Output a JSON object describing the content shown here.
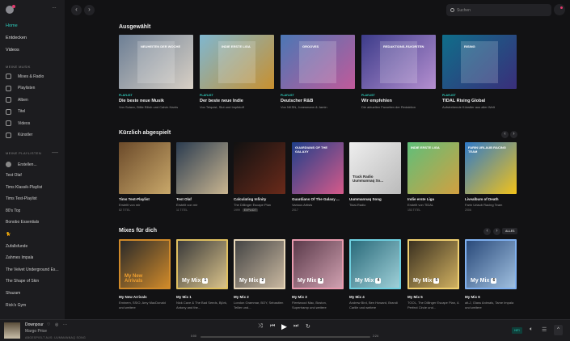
{
  "sidebar": {
    "nav": [
      {
        "label": "Home",
        "active": true
      },
      {
        "label": "Entdecken"
      },
      {
        "label": "Videos"
      }
    ],
    "my_music_title": "MEINE MUSIK",
    "my_music": [
      {
        "label": "Mixes & Radio",
        "icon": "radio-icon"
      },
      {
        "label": "Playlisten",
        "icon": "playlist-icon"
      },
      {
        "label": "Alben",
        "icon": "album-icon"
      },
      {
        "label": "Titel",
        "icon": "note-icon"
      },
      {
        "label": "Videos",
        "icon": "video-icon"
      },
      {
        "label": "Künstler",
        "icon": "mic-icon"
      }
    ],
    "playlists_title": "MEINE PLAYLISTEN",
    "create_label": "Erstellen...",
    "playlists": [
      "Test Olaf",
      "Tims Klassik-Playlist",
      "Tims Test-Playlist",
      "80's Top",
      "Bonobo Essentials",
      "🐈",
      "Zufallsfunde",
      "Zahmes Impala",
      "The Velvet Underground Es...",
      "The Shape of Skin",
      "Shazam",
      "Rick's Gym"
    ]
  },
  "header": {
    "search_placeholder": "Suchen"
  },
  "featured": {
    "title": "Ausgewählt",
    "items": [
      {
        "tag": "PLAYLIST",
        "title": "Die beste neue Musik",
        "sub": "Von Sulavx, Billie Eilish und Calvin Harris",
        "art_text": "Neuheiten der Woche",
        "colors": [
          "#6d7f95",
          "#d8d0c5"
        ]
      },
      {
        "tag": "PLAYLIST",
        "title": "Der beste neue Indie",
        "sub": "Von Telquist, Slut und Impfstoff",
        "art_text": "Indie Erste Liga",
        "colors": [
          "#7fb7d0",
          "#c8902f"
        ]
      },
      {
        "tag": "PLAYLIST",
        "title": "Deutscher R&B",
        "sub": "Von NKSN, Jonesmann & Jamin",
        "art_text": "Grooves",
        "colors": [
          "#4b77b5",
          "#c05a9a"
        ]
      },
      {
        "tag": "PLAYLIST",
        "title": "Wir empfehlen",
        "sub": "Die aktuellen Favoriten der Redaktion",
        "art_text": "Redaktions-favoriten",
        "colors": [
          "#3c3c8a",
          "#b58fd0"
        ]
      },
      {
        "tag": "PLAYLIST",
        "title": "TIDAL Rising Global",
        "sub": "Aufstrebende Künstler aus aller Welt",
        "art_text": "Rising",
        "colors": [
          "#0f6e8a",
          "#3a2e7a"
        ]
      }
    ]
  },
  "recent": {
    "title": "Kürzlich abgespielt",
    "items": [
      {
        "title": "Tims Test-Playlist",
        "sub": "Erstellt von mir",
        "meta": "82 TITEL",
        "colors": [
          "#6b4a2a",
          "#c9a86a"
        ]
      },
      {
        "title": "Test Olaf",
        "sub": "Erstellt von mir",
        "meta": "11 TITEL",
        "colors": [
          "#2b3c50",
          "#c9b590"
        ]
      },
      {
        "title": "Calculating Infinity",
        "sub": "The Dillinger Escape Plan",
        "meta": "1999",
        "badge": "EXPLICIT",
        "colors": [
          "#111",
          "#6a2a1a"
        ]
      },
      {
        "title": "Guardians Of The Galaxy ...",
        "sub": "Various Artists",
        "meta": "2017",
        "art_text": "Guardians of the Galaxy",
        "colors": [
          "#1f3f8a",
          "#d65a8a"
        ]
      },
      {
        "title": "Uummannaq Song",
        "sub": "Tidal-Radio",
        "art_text": "Track Radio Uummannaq So...",
        "colors": [
          "#eeeeee",
          "#bbbbbb"
        ]
      },
      {
        "title": "Indie erste Liga",
        "sub": "Erstellt von TIDAL",
        "meta": "153 TITEL",
        "art_text": "Indie Erste Liga",
        "colors": [
          "#5fbf7a",
          "#d2a040"
        ]
      },
      {
        "title": "Livealbum of Death",
        "sub": "Farin Urlaub Racing Team",
        "meta": "2006",
        "art_text": "Farin Urlaub Racing Team",
        "colors": [
          "#2f7ac9",
          "#f2c21a"
        ]
      }
    ]
  },
  "mixes": {
    "title": "Mixes für dich",
    "all_label": "ALLES",
    "items": [
      {
        "title": "My New Arrivals",
        "sub": "Eminem, SSIO, Amy MacDonald und weitere",
        "art_label": "My New Arrivals",
        "colors": [
          "#2a2a2a",
          "#d08a2a"
        ],
        "border": "#d08a2a"
      },
      {
        "title": "My Mix 1",
        "sub": "Nick Cave & The Bad Seeds, Björk, Antony and the...",
        "art_label": "My Mix",
        "num": "1",
        "colors": [
          "#3a3a3a",
          "#d9c28a"
        ],
        "border": "#e0c060"
      },
      {
        "title": "My Mix 2",
        "sub": "London Grammar, BOY, Sebastien Tellier und...",
        "art_label": "My Mix",
        "num": "2",
        "colors": [
          "#444",
          "#c9b8a0"
        ],
        "border": "#e7d6b8"
      },
      {
        "title": "My Mix 3",
        "sub": "Fleetwood Mac, Boston, Supertramp und weitere",
        "art_label": "My Mix",
        "num": "3",
        "colors": [
          "#5a3a4a",
          "#d0a0b0"
        ],
        "border": "#e89aae"
      },
      {
        "title": "My Mix 4",
        "sub": "Andrew Bird, Ben Howard, Brandi Carlile und weitere",
        "art_label": "My Mix",
        "num": "4",
        "colors": [
          "#2a6a7a",
          "#9fd0d8"
        ],
        "border": "#6fd0e0"
      },
      {
        "title": "My Mix 5",
        "sub": "TOOL, The Dillinger Escape Plan, A Perfect Circle und...",
        "art_label": "My Mix",
        "num": "5",
        "colors": [
          "#3a3020",
          "#d0b060"
        ],
        "border": "#f0d070"
      },
      {
        "title": "My Mix 6",
        "sub": "alt-J, Glass Animals, Tame Impala und weitere",
        "art_label": "My Mix",
        "num": "6",
        "colors": [
          "#2a4a7a",
          "#a0c0e0"
        ],
        "border": "#7fb0f0"
      }
    ]
  },
  "player": {
    "title": "Downpour",
    "artist": "Margo Price",
    "from": "ABGESPIELT AUS: UUMMANNAQ SONG",
    "elapsed": "0:00",
    "duration": "2:24",
    "progress": 0,
    "quality": "HIFI"
  }
}
